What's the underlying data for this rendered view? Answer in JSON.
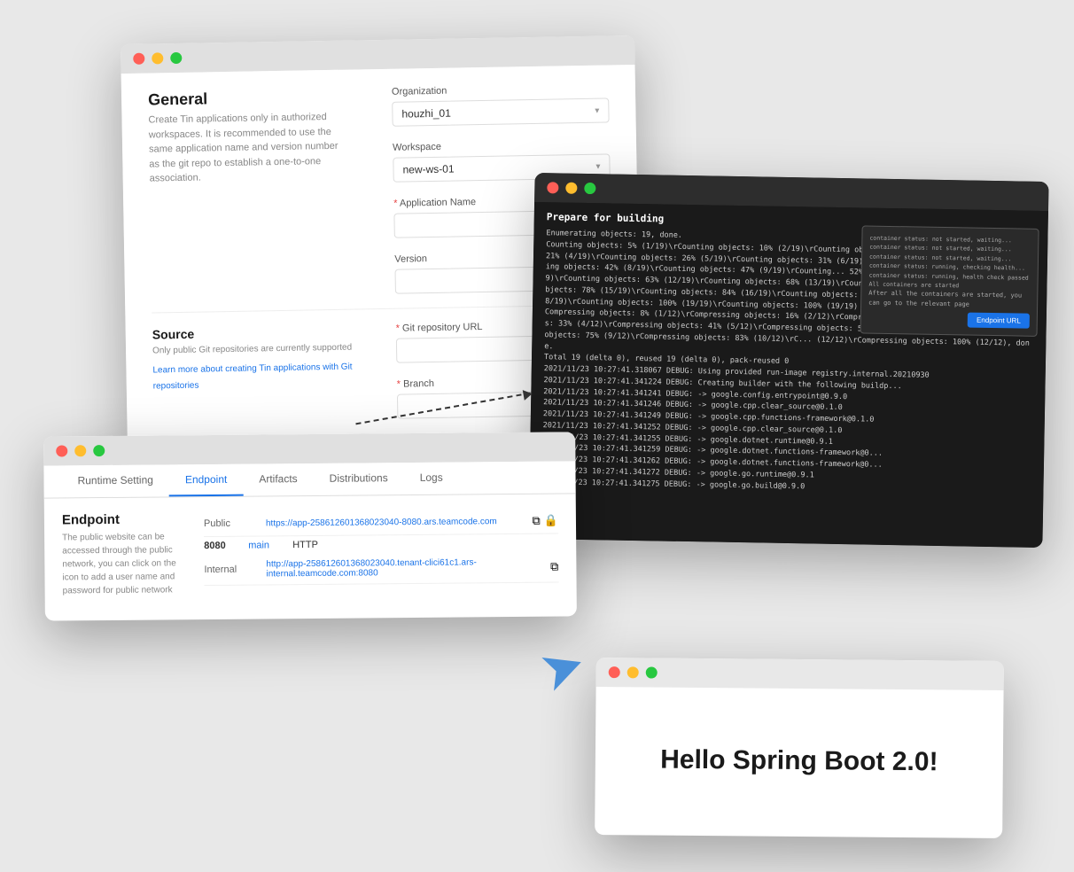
{
  "window_form": {
    "title": "General",
    "description": "Create Tin applications only in authorized workspaces. It is recommended to use the same application name and version number as the git repo to establish a one-to-one association.",
    "org_label": "Organization",
    "org_value": "houzhi_01",
    "workspace_label": "Workspace",
    "workspace_value": "new-ws-01",
    "app_name_label": "Application Name",
    "version_label": "Version",
    "source_title": "Source",
    "source_desc": "Only public Git repositories are currently supported",
    "source_link": "Learn more about creating Tin applications with Git repositories",
    "git_url_label": "Git repository URL",
    "branch_label": "Branch"
  },
  "window_terminal": {
    "prepare_text": "Prepare for building",
    "log_text": "Enumerating objects: 19, done.\nCounting objects: 5% (1/19)\\rCounting objects: 10% (2/19)\\rCounting objects: 15% (3/19)\\rCounting objects: 21% (4/19)\\rCounting objects: 26% (5/19)\\rCounting objects: 31% (6/19)\\rCounting objects: 36% (7/19)\\rCounting objects: 42% (8/19)\\rCounting objects: 47% (9/19)\\rCounting... 52% (10/19)\\rCounting objects: 57% (11/19)\\rCounting objects: 63% (12/19)\\rCounting objects: 68% (13/19)\\rCounting objects: 73% (14/19)\\rCounting objects: 78% (15/19)\\rCounting objects: 84% (16/19)\\rCounting objects: 89% (17/19)\\rCounting objects: 94% (18/19)\\rCounting objects: 100% (19/19)\\rCounting objects: 100% (19/19)\nCompressing objects: 8% (1/12)\\rCompressing objects: 16% (2/12)\\rCompress... 25% (3/12)\\rCompressing objects: 33% (4/12)\\rCompressing objects: 41% (5/12)\\rCompressing objects: 50% (6/12)\\rCo... (8/12)\\rCompressing objects: 75% (9/12)\\rCompressing objects: 83% (10/12)\\rC... (12/12)\\rCompressing objects: 100% (12/12), done.\nTotal 19 (delta 0), reused 19 (delta 0), pack-reused 0\n2021/11/23 10:27:41.318067 DEBUG: Using provided run-image registry.internal.20210930\n2021/11/23 10:27:41.341224 DEBUG: Creating builder with the following buildp...\n2021/11/23 10:27:41.341241 DEBUG: -> google.config.entrypoint@0.9.0\n2021/11/23 10:27:41.341246 DEBUG: -> google.cpp.clear_source@0.1.0\n2021/11/23 10:27:41.341249 DEBUG: -> google.cpp.functions-framework@0.1.0\n2021/11/23 10:27:41.341252 DEBUG: -> google.cpp.clear_source@0.1.0\n2021/11/23 10:27:41.341255 DEBUG: -> google.dotnet.runtime@0.9.1\n2021/11/23 10:27:41.341259 DEBUG: -> google.dotnet.functions-framework@0...\n2021/11/23 10:27:41.341262 DEBUG: -> google.dotnet.functions-framework@0...\n2021/11/23 10:27:41.341272 DEBUG: -> google.go.runtime@0.9.1\n2021/11/23 10:27:41.341275 DEBUG: -> google.go.build@0.9.0",
    "overlay_text": "After all the containers are started, you can go to the relevant page",
    "endpoint_btn": "Endpoint URL"
  },
  "window_endpoint": {
    "tabs": [
      {
        "label": "Runtime Setting",
        "active": false
      },
      {
        "label": "Endpoint",
        "active": true
      },
      {
        "label": "Artifacts",
        "active": false
      },
      {
        "label": "Distributions",
        "active": false
      },
      {
        "label": "Logs",
        "active": false
      }
    ],
    "section_title": "Endpoint",
    "section_desc": "The public website can be accessed through the public network, you can click on the icon to add a user name and password for public network",
    "rows": [
      {
        "port": "8080",
        "name": "main",
        "proto": "HTTP",
        "type": "Public",
        "url": "https://app-258612601368023040-8080.ars.teamcode.com",
        "icons": [
          "copy",
          "lock"
        ]
      },
      {
        "port": "",
        "name": "",
        "proto": "",
        "type": "Internal",
        "url": "http://app-258612601368023040.tenant-clici61c1.ars-internal.teamcode.com:8080",
        "icons": [
          "copy"
        ]
      }
    ]
  },
  "window_hello": {
    "text": "Hello Spring Boot 2.0!"
  }
}
